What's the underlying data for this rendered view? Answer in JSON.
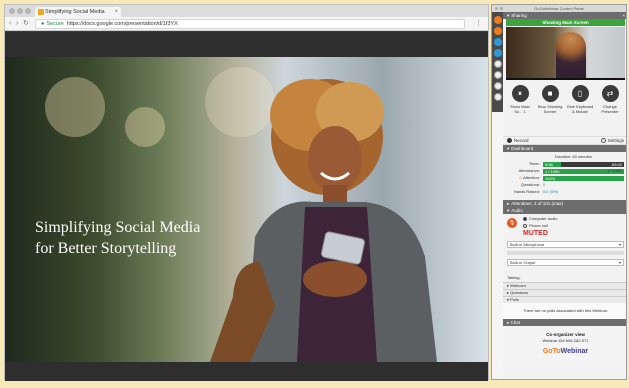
{
  "browser": {
    "tab_title": "Simplifying Social Media",
    "tab_close": "×",
    "nav_back": "‹",
    "nav_forward": "›",
    "nav_reload": "↻",
    "secure_label": "Secure",
    "url": "https://docs.google.com/presentation/d/1f3YX",
    "menu_icon": "⋮"
  },
  "slide": {
    "title_line1": "Simplifying Social Media",
    "title_line2": "for Better Storytelling"
  },
  "panel": {
    "window_title": "GoToWebinar Control Panel",
    "sharing": {
      "header": "Sharing",
      "status": "Showing Main Screen",
      "buttons": [
        {
          "label": "Show Main Sc... 1",
          "glyph": "⏸"
        },
        {
          "label": "Stop Showing Screen",
          "glyph": "■"
        },
        {
          "label": "Give Keyboard & Mouse",
          "glyph": "▯"
        },
        {
          "label": "Change Presenter",
          "glyph": "⇄"
        }
      ],
      "record_label": "Record",
      "settings_label": "Settings"
    },
    "dashboard": {
      "header": "Dashboard",
      "duration_label": "Duration: 60 minutes",
      "timer_label": "Timer:",
      "timer_elapsed": "5:58",
      "timer_remaining": "-55:52",
      "attendance_label": "Attendance:",
      "attendance_value": "1 / 1000",
      "attendance_right": "1 / 1000",
      "attention_label": "Attention:",
      "attention_value": "100%",
      "questions_label": "Questions:",
      "questions_value": "0",
      "handraises_label": "Hands Raised:",
      "handraises_value": "0/1 (0%)"
    },
    "attendees_header": "Attendees: 2 of 101 (max)",
    "audio": {
      "header": "Audio",
      "computer_audio": "Computer audio",
      "phone_call": "Phone call",
      "muted": "MUTED",
      "mic_device": "Built-in Microphone",
      "speaker_device": "Built-in Output"
    },
    "talking_label": "Talking:",
    "webcam_header": "Webcam",
    "questions_header": "Questions",
    "polls_header": "Polls",
    "polls_message": "There are no polls associated with this Webinar.",
    "chat_header": "Chat",
    "footer": {
      "co_organizer": "Co-organizer view",
      "webinar_id": "Webinar ID# 608-282-971",
      "brand_prefix": "GoTo",
      "brand_suffix": "Webinar"
    }
  }
}
